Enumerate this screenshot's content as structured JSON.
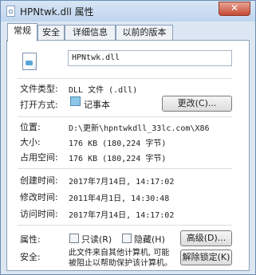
{
  "window": {
    "title": "HPNtwk.dll 属性",
    "close_glyph": "✕"
  },
  "tabs": [
    {
      "label": "常规",
      "active": true
    },
    {
      "label": "安全",
      "active": false
    },
    {
      "label": "详细信息",
      "active": false
    },
    {
      "label": "以前的版本",
      "active": false
    }
  ],
  "file": {
    "name": "HPNtwk.dll"
  },
  "general": {
    "type_label": "文件类型:",
    "type_value": "DLL 文件 (.dll)",
    "open_label": "打开方式:",
    "open_app": "记事本",
    "change_button": "更改(C)...",
    "location_label": "位置:",
    "location_value": "D:\\更新\\hpntwkdll_33lc.com\\X86",
    "size_label": "大小:",
    "size_value": "176 KB (180,224 字节)",
    "disk_label": "占用空间:",
    "disk_value": "176 KB (180,224 字节)",
    "created_label": "创建时间:",
    "created_value": "2017年7月14日, 14:17:02",
    "modified_label": "修改时间:",
    "modified_value": "2011年4月1日, 14:30:48",
    "accessed_label": "访问时间:",
    "accessed_value": "2017年7月14日, 14:17:02",
    "attributes_label": "属性:",
    "readonly_label": "只读(R)",
    "hidden_label": "隐藏(H)",
    "advanced_button": "高级(D)...",
    "security_label": "安全:",
    "security_text": "此文件来自其他计算机, 可能被阻止以帮助保护该计算机。",
    "unblock_button": "解除锁定(K)"
  },
  "colors": {
    "window_frame": "#dde7f3",
    "close_button": "#c64a35"
  },
  "icons": {
    "file": "dll-file-icon",
    "notepad": "notepad-icon",
    "close": "close-icon"
  }
}
